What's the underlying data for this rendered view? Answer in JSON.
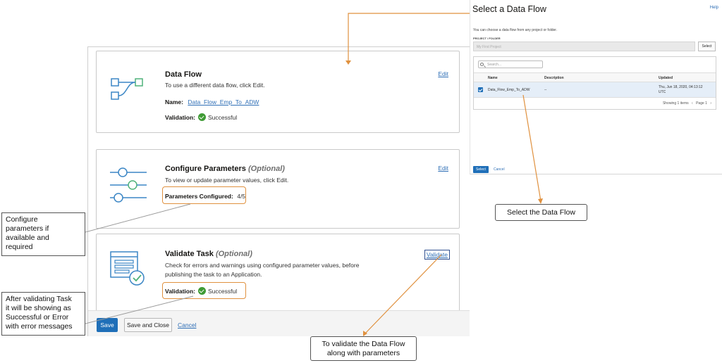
{
  "left": {
    "dataflow": {
      "title": "Data Flow",
      "desc": "To use a different data flow, click Edit.",
      "name_label": "Name:",
      "name_value": "Data_Flow_Emp_To_ADW",
      "validation_label": "Validation:",
      "validation_value": "Successful",
      "edit": "Edit"
    },
    "params": {
      "title": "Configure Parameters",
      "optional": "(Optional)",
      "desc": "To view or update parameter values, click Edit.",
      "configured_label": "Parameters Configured:",
      "configured_value": "4/5",
      "edit": "Edit"
    },
    "validate": {
      "title": "Validate Task",
      "optional": "(Optional)",
      "desc1": "Check for errors and warnings using configured parameter values, before",
      "desc2": "publishing the task to an Application.",
      "validation_label": "Validation:",
      "validation_value": "Successful",
      "action": "Validate"
    },
    "footer": {
      "save": "Save",
      "save_close": "Save and Close",
      "cancel": "Cancel"
    }
  },
  "callouts": {
    "configure": [
      "Configure",
      "parameters if",
      "available and",
      "required"
    ],
    "after_validating": [
      "After validating Task",
      "it will be showing as",
      "Successful or Error",
      "with error messages"
    ],
    "select_flow": "Select the Data Flow",
    "validate_flow": [
      "To validate the Data Flow",
      "along with parameters"
    ]
  },
  "right": {
    "title": "Select a Data Flow",
    "help": "Help",
    "intro": "You can choose a data flow from any project or folder.",
    "project_label": "PROJECT / FOLDER",
    "project_value": "My First Project",
    "select_btn": "Select",
    "search_placeholder": "Search...",
    "columns": [
      "Name",
      "Description",
      "Updated"
    ],
    "row": {
      "name": "Data_Flow_Emp_To_ADW",
      "description": "--",
      "updated1": "Thu, Jun 18, 2020, 04:13:12",
      "updated2": "UTC"
    },
    "pager": "Showing 1 items",
    "page": "Page 1",
    "select_primary": "Select",
    "cancel": "Cancel"
  },
  "colors": {
    "accent_orange": "#e0913f",
    "primary_blue": "#1f6fb8",
    "link_blue": "#2f6fb6",
    "success_green": "#3f9b35"
  }
}
